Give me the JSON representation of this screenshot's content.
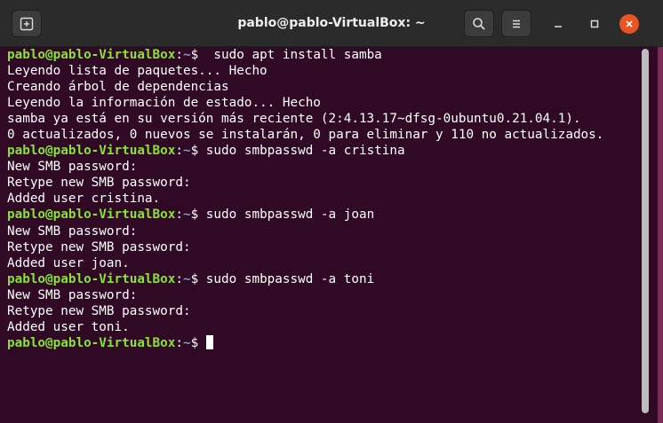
{
  "window": {
    "title": "pablo@pablo-VirtualBox: ~"
  },
  "toolbar": {
    "new_tab_icon": "new-tab-icon",
    "search_icon": "search-icon",
    "menu_icon": "hamburger-menu-icon",
    "minimize_icon": "minimize-icon",
    "maximize_icon": "maximize-icon",
    "close_icon": "close-icon"
  },
  "colors": {
    "terminal_bg": "#300a24",
    "prompt_user": "#8ae234",
    "prompt_path": "#729fcf",
    "text": "#ffffff",
    "titlebar": "#2b2b2b",
    "close_button": "#e95420"
  },
  "terminal": {
    "lines": [
      {
        "type": "prompt",
        "user": "pablo@pablo-VirtualBox",
        "sep": ":",
        "path": "~",
        "sym": "$",
        "cmd": "  sudo apt install samba"
      },
      {
        "type": "output",
        "text": "Leyendo lista de paquetes... Hecho"
      },
      {
        "type": "output",
        "text": "Creando árbol de dependencias"
      },
      {
        "type": "output",
        "text": "Leyendo la información de estado... Hecho"
      },
      {
        "type": "output",
        "text": "samba ya está en su versión más reciente (2:4.13.17~dfsg-0ubuntu0.21.04.1)."
      },
      {
        "type": "output",
        "text": "0 actualizados, 0 nuevos se instalarán, 0 para eliminar y 110 no actualizados."
      },
      {
        "type": "prompt",
        "user": "pablo@pablo-VirtualBox",
        "sep": ":",
        "path": "~",
        "sym": "$",
        "cmd": " sudo smbpasswd -a cristina"
      },
      {
        "type": "output",
        "text": "New SMB password:"
      },
      {
        "type": "output",
        "text": "Retype new SMB password:"
      },
      {
        "type": "output",
        "text": "Added user cristina."
      },
      {
        "type": "prompt",
        "user": "pablo@pablo-VirtualBox",
        "sep": ":",
        "path": "~",
        "sym": "$",
        "cmd": " sudo smbpasswd -a joan"
      },
      {
        "type": "output",
        "text": "New SMB password:"
      },
      {
        "type": "output",
        "text": "Retype new SMB password:"
      },
      {
        "type": "output",
        "text": "Added user joan."
      },
      {
        "type": "prompt",
        "user": "pablo@pablo-VirtualBox",
        "sep": ":",
        "path": "~",
        "sym": "$",
        "cmd": " sudo smbpasswd -a toni"
      },
      {
        "type": "output",
        "text": "New SMB password:"
      },
      {
        "type": "output",
        "text": "Retype new SMB password:"
      },
      {
        "type": "output",
        "text": "Added user toni."
      },
      {
        "type": "prompt",
        "user": "pablo@pablo-VirtualBox",
        "sep": ":",
        "path": "~",
        "sym": "$",
        "cmd": " ",
        "cursor": true
      }
    ]
  }
}
